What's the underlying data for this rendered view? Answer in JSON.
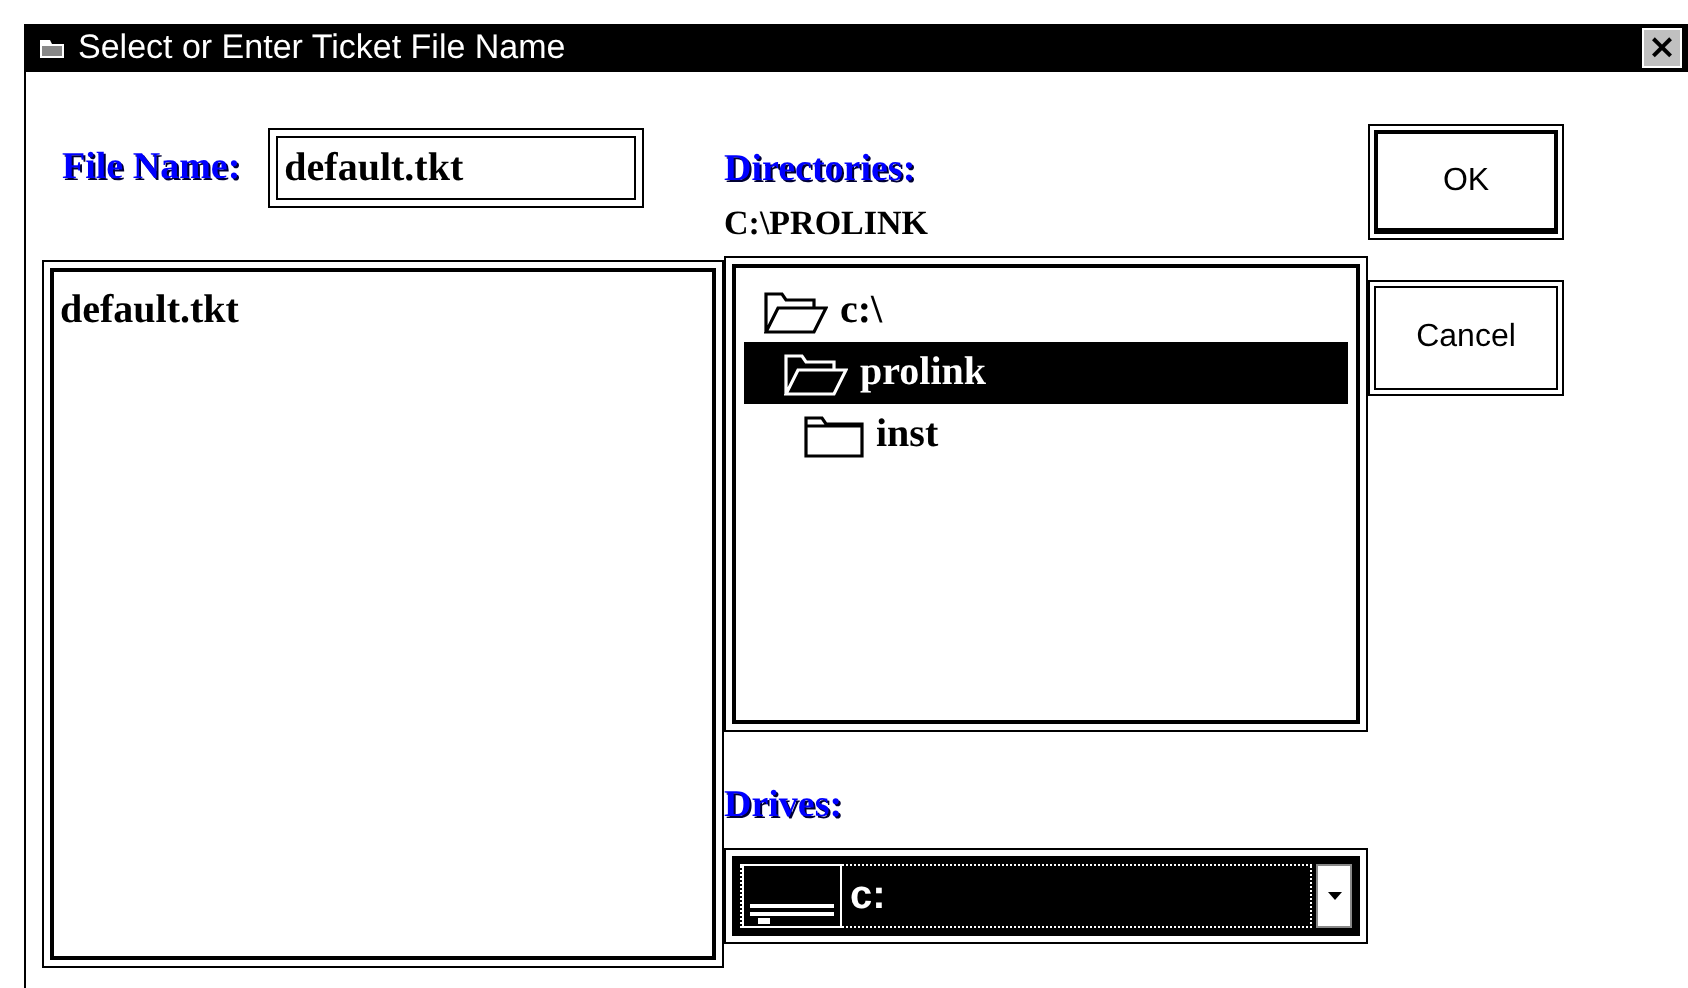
{
  "window": {
    "title": "Select or Enter Ticket File Name",
    "close": "×"
  },
  "file_name": {
    "label": "File Name:",
    "value": "default.tkt"
  },
  "files": [
    {
      "name": "default.tkt",
      "selected": false
    }
  ],
  "directories": {
    "label": "Directories:",
    "path": "C:\\PROLINK",
    "tree": [
      {
        "name": "c:\\",
        "expanded": true,
        "selected": false,
        "children": [
          {
            "name": "prolink",
            "expanded": true,
            "selected": true,
            "children": [
              {
                "name": "inst",
                "expanded": false,
                "selected": false
              }
            ]
          }
        ]
      }
    ]
  },
  "drives": {
    "label": "Drives:",
    "value": "c:"
  },
  "buttons": [
    {
      "label": "OK",
      "default": true
    },
    {
      "label": "Cancel",
      "default": false
    }
  ]
}
